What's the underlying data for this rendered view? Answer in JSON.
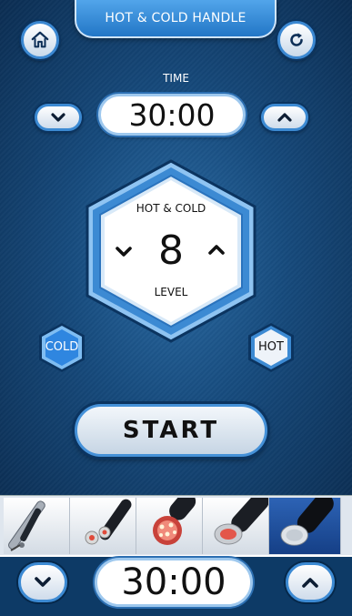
{
  "header": {
    "title": "HOT & COLD HANDLE"
  },
  "icons": {
    "home": "home-icon",
    "reset": "refresh-icon"
  },
  "timer": {
    "label": "TIME",
    "value": "30:00"
  },
  "level": {
    "title": "HOT & COLD",
    "value": "8",
    "label": "LEVEL"
  },
  "modes": {
    "cold": "COLD",
    "hot": "HOT",
    "selected": "cold"
  },
  "start": {
    "label": "START"
  },
  "handles": {
    "items": [
      "handle-probe",
      "handle-red-light-dual",
      "handle-multi-led",
      "handle-red-round",
      "handle-hot-cold"
    ],
    "selected_index": 4
  },
  "zoom_bar": {
    "value": "30:00"
  },
  "colors": {
    "accent": "#2f7fd0",
    "panel": "#164a7c",
    "active_hex": "#2f86e0"
  }
}
